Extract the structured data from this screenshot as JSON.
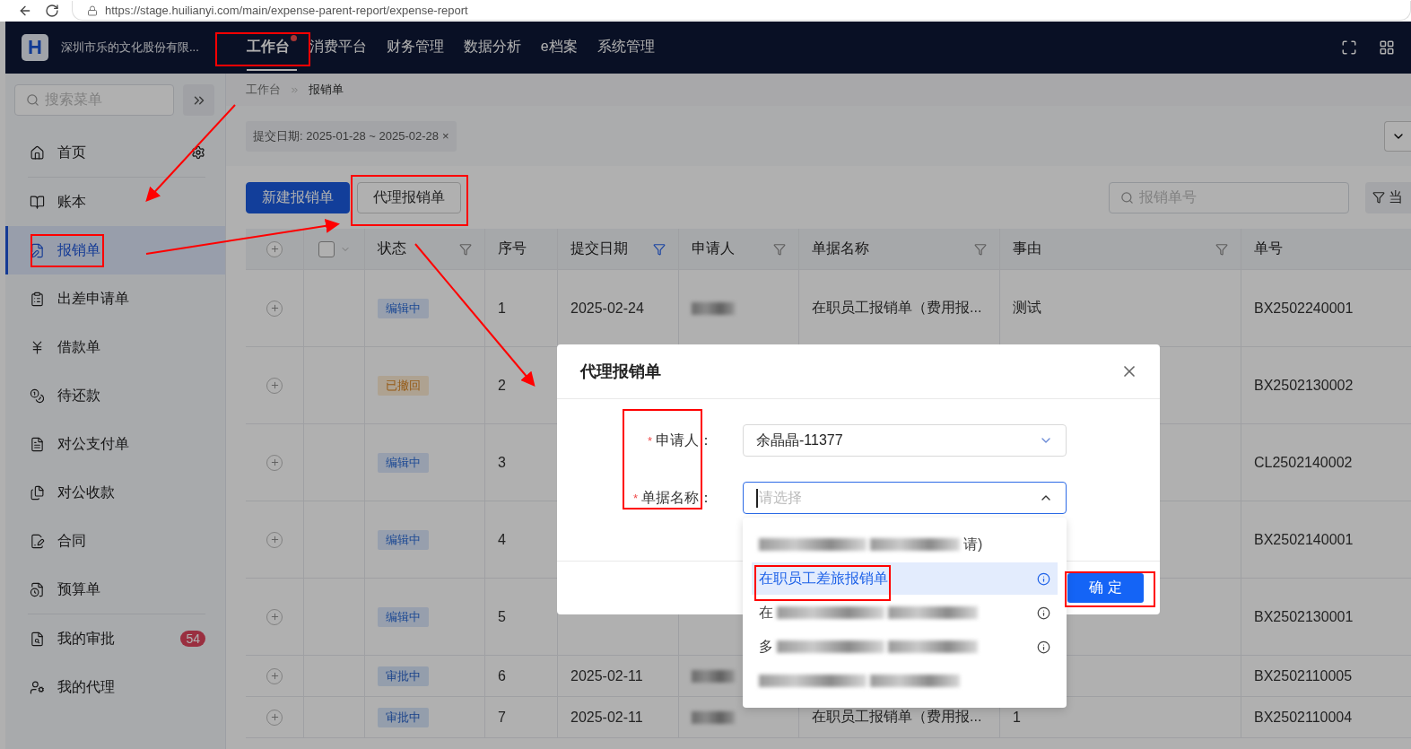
{
  "browser": {
    "url": "https://stage.huilianyi.com/main/expense-parent-report/expense-report"
  },
  "header": {
    "logo": "H",
    "company": "深圳市乐的文化股份有限...",
    "nav": [
      {
        "label": "工作台",
        "selected": true,
        "dot": true
      },
      {
        "label": "消费平台",
        "selected": false,
        "dot": false
      },
      {
        "label": "财务管理",
        "selected": false,
        "dot": false
      },
      {
        "label": "数据分析",
        "selected": false,
        "dot": false
      },
      {
        "label": "e档案",
        "selected": false,
        "dot": false
      },
      {
        "label": "系统管理",
        "selected": false,
        "dot": false
      }
    ]
  },
  "sidebar": {
    "search_placeholder": "搜索菜单",
    "items": [
      {
        "label": "首页",
        "selected": false,
        "gear": true,
        "divider_after": true
      },
      {
        "label": "账本",
        "selected": false
      },
      {
        "label": "报销单",
        "selected": true
      },
      {
        "label": "出差申请单",
        "selected": false
      },
      {
        "label": "借款单",
        "selected": false
      },
      {
        "label": "待还款",
        "selected": false
      },
      {
        "label": "对公支付单",
        "selected": false
      },
      {
        "label": "对公收款",
        "selected": false
      },
      {
        "label": "合同",
        "selected": false
      },
      {
        "label": "预算单",
        "selected": false,
        "divider_after": true
      },
      {
        "label": "我的审批",
        "selected": false,
        "badge": "54"
      },
      {
        "label": "我的代理",
        "selected": false
      }
    ]
  },
  "breadcrumb": [
    "工作台",
    "报销单"
  ],
  "filter_tag": {
    "label": "提交日期: 2025-01-28 ~ 2025-02-28",
    "close": "×"
  },
  "toolbar": {
    "buttons": [
      {
        "label": "新建报销单",
        "kind": "primary"
      },
      {
        "label": "代理报销单",
        "kind": "default"
      }
    ],
    "search_placeholder": "报销单号",
    "filter_button": "当"
  },
  "table": {
    "select_all": {
      "checked": false
    },
    "columns": [
      {
        "kind": "expand"
      },
      {
        "kind": "check"
      },
      {
        "label": "状态",
        "kind": "text",
        "filter": true
      },
      {
        "label": "序号",
        "kind": "text"
      },
      {
        "label": "提交日期",
        "kind": "text",
        "filter": true,
        "filter_active": true
      },
      {
        "label": "申请人",
        "kind": "text",
        "filter": true
      },
      {
        "label": "单据名称",
        "kind": "text",
        "filter": true
      },
      {
        "label": "事由",
        "kind": "text",
        "filter": true
      },
      {
        "label": "单号",
        "kind": "text"
      }
    ],
    "rows": [
      {
        "tall": true,
        "status": "编辑中",
        "kind": "editing",
        "index": "1",
        "date": "2025-02-24",
        "applicant_redacted": true,
        "name": "在职员工报销单（费用报...",
        "reason": "测试",
        "number": "BX2502240001"
      },
      {
        "tall": true,
        "status": "已撤回",
        "kind": "withdrawn",
        "index": "2",
        "applicant_redacted": false,
        "number": "BX2502130002"
      },
      {
        "tall": true,
        "status": "编辑中",
        "kind": "editing",
        "index": "3",
        "applicant_redacted": false,
        "number": "CL2502140002"
      },
      {
        "tall": true,
        "status": "编辑中",
        "kind": "editing",
        "index": "4",
        "applicant_redacted": false,
        "number": "BX2502140001"
      },
      {
        "tall": true,
        "status": "编辑中",
        "kind": "editing",
        "index": "5",
        "applicant_redacted": false,
        "number": "BX2502130001"
      },
      {
        "tall": false,
        "status": "审批中",
        "kind": "approving",
        "index": "6",
        "date": "2025-02-11",
        "applicant_redacted": true,
        "number": "BX2502110005"
      },
      {
        "tall": false,
        "status": "审批中",
        "kind": "approving",
        "index": "7",
        "date": "2025-02-11",
        "applicant_redacted": true,
        "name": "在职员工报销单（费用报...",
        "reason": "1",
        "number": "BX2502110004"
      }
    ]
  },
  "dialog": {
    "title": "代理报销单",
    "fields": [
      {
        "label": "申请人：",
        "required_mark": "*",
        "value": "余晶晶-11377",
        "open": false
      },
      {
        "label": "单据名称：",
        "required_mark": "*",
        "placeholder": "请选择",
        "open": true
      }
    ],
    "confirm": "确 定",
    "options": [
      {
        "end": "请)",
        "redacted": true,
        "selected": false,
        "info": false
      },
      {
        "start": "在职员工差旅报销单",
        "redacted": false,
        "selected": true,
        "info": true
      },
      {
        "start": "在",
        "redacted": true,
        "selected": false,
        "info": true
      },
      {
        "start": "多",
        "redacted": true,
        "selected": false,
        "info": true
      },
      {
        "redacted": true,
        "selected": false,
        "info": false
      }
    ]
  }
}
